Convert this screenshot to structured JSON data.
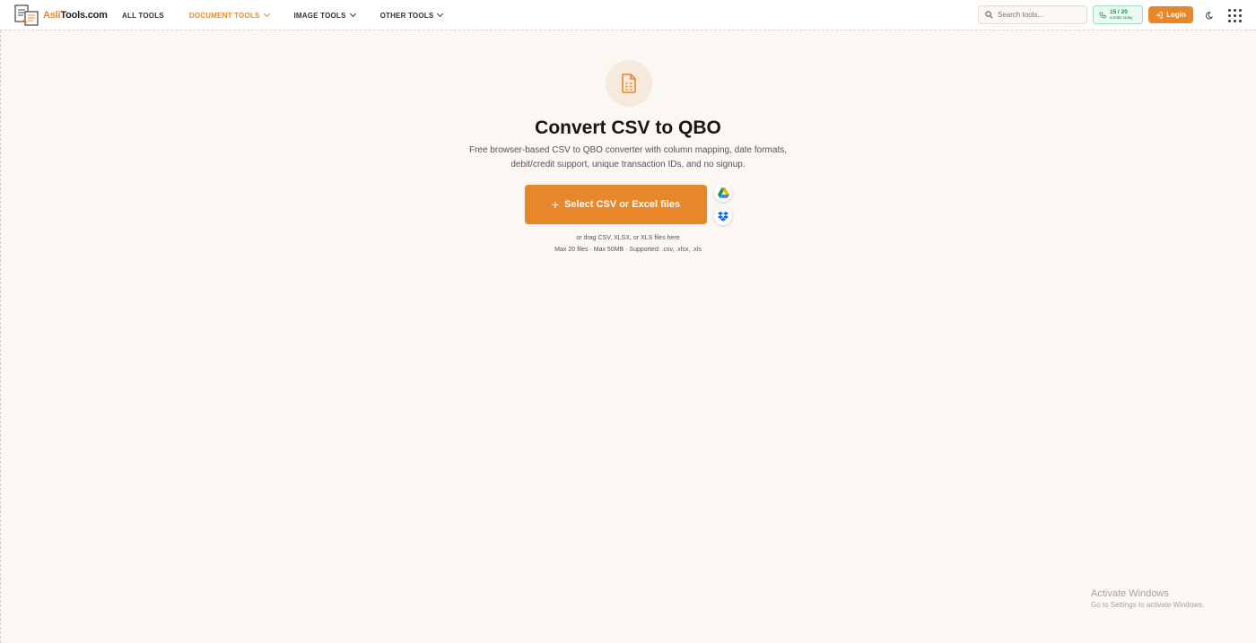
{
  "header": {
    "logo": {
      "brand_accent": "Asli",
      "brand_rest": "Tools.com"
    },
    "nav": [
      {
        "label": "ALL TOOLS",
        "has_dropdown": false
      },
      {
        "label": "DOCUMENT TOOLS",
        "has_dropdown": true,
        "active": true
      },
      {
        "label": "IMAGE TOOLS",
        "has_dropdown": true
      },
      {
        "label": "OTHER TOOLS",
        "has_dropdown": true
      }
    ],
    "search": {
      "placeholder": "Search tools...",
      "value": "",
      "icon": "search-icon"
    },
    "credits": {
      "count": "15 / 20",
      "sub": "credits today",
      "icon": "phone-icon"
    },
    "login_label": "Login",
    "theme_icon": "moon-icon",
    "apps_icon": "grid-icon"
  },
  "hero": {
    "icon": "document-icon",
    "title": "Convert CSV to QBO",
    "subtitle": "Free browser-based CSV to QBO converter with column mapping, date formats, debit/credit support, unique transaction IDs, and no signup.",
    "select_label": "Select CSV or Excel files",
    "drag_hint": "or drag CSV, XLSX, or XLS files here",
    "limits": "Max 20 files · Max 50MB · Supported: .csv, .xlsx, .xls",
    "cloud": [
      "google-drive-icon",
      "dropbox-icon"
    ]
  },
  "watermark": {
    "line1": "Activate Windows",
    "line2": "Go to Settings to activate Windows."
  },
  "colors": {
    "accent": "#e8872a",
    "background": "#fbf7f2",
    "credits_green": "#1a8a4c"
  }
}
